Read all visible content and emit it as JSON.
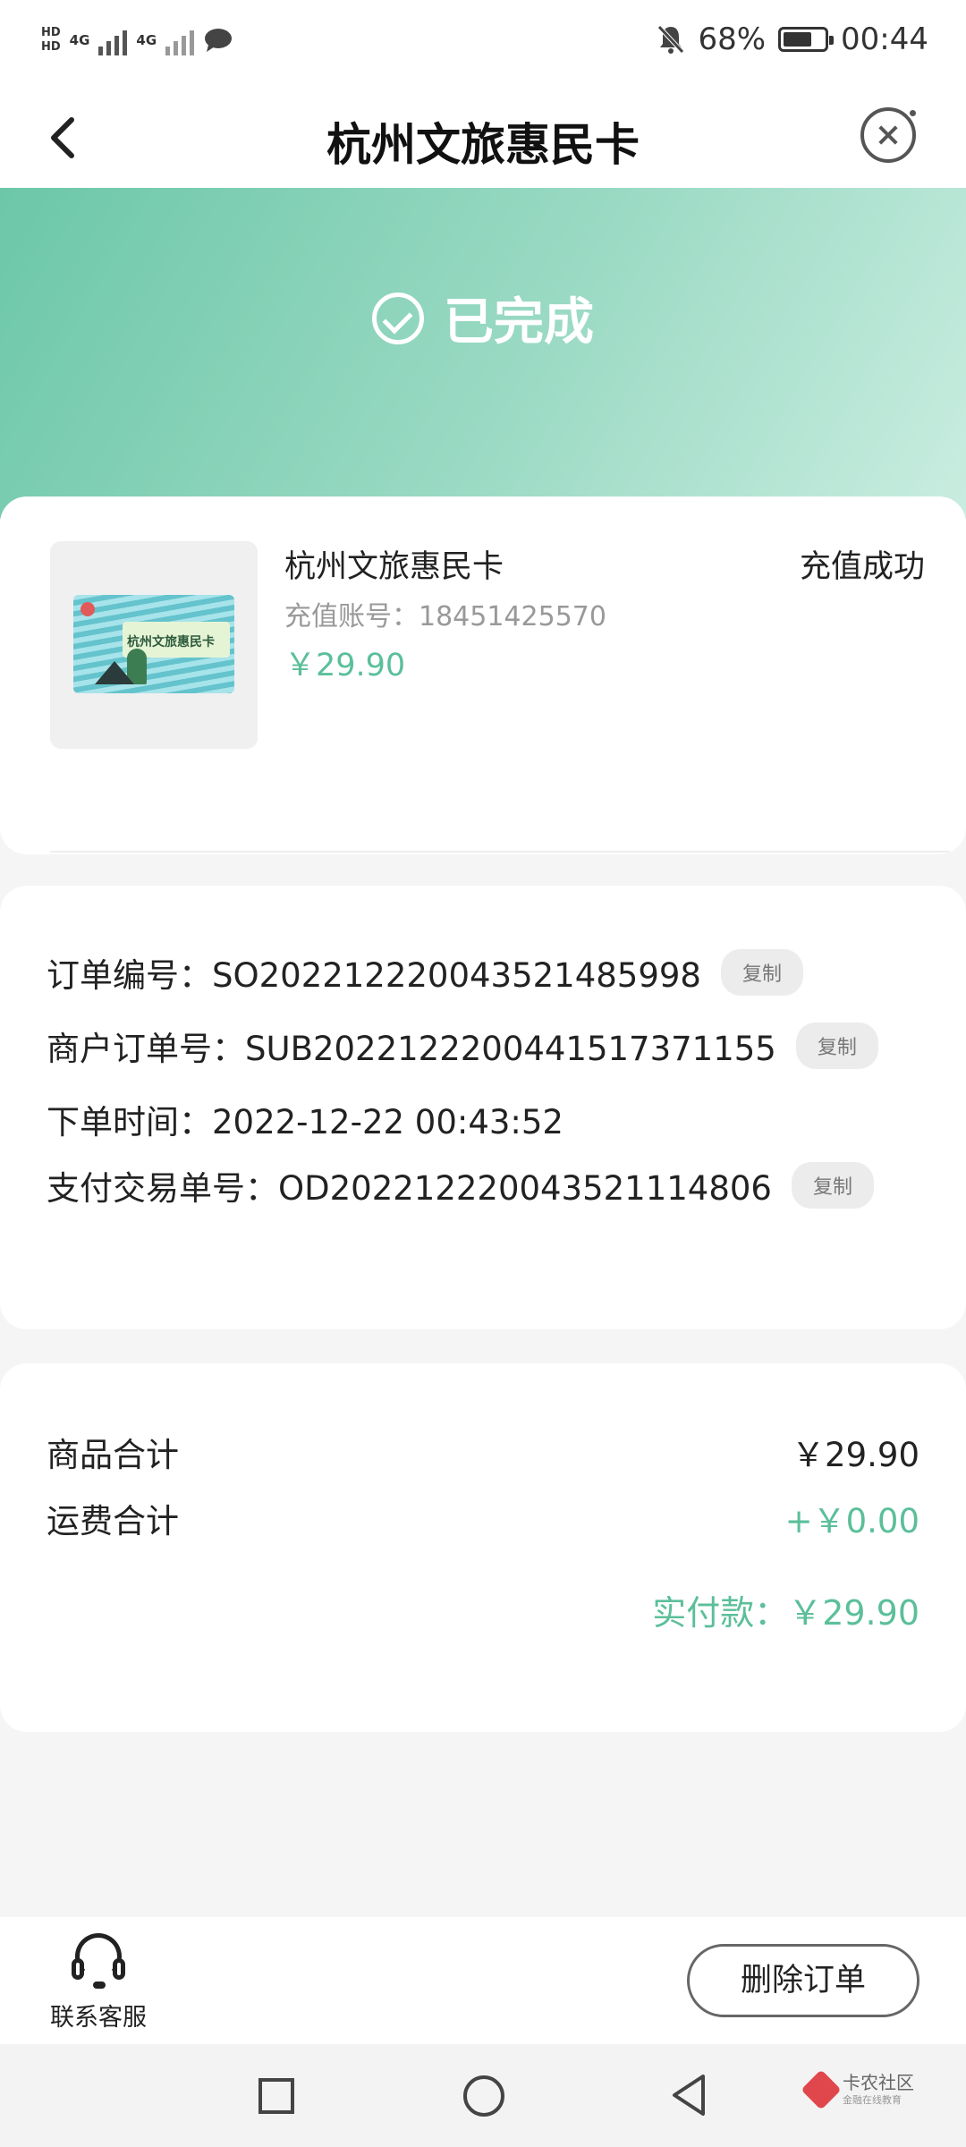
{
  "status_bar": {
    "network_left": "HD",
    "network_type_1": "4G",
    "network_type_2": "4G",
    "battery_percent": "68%",
    "time": "00:44",
    "icons": [
      "signal-icon",
      "chat-bubble-icon",
      "mute-bell-icon",
      "battery-icon"
    ]
  },
  "header": {
    "title": "杭州文旅惠民卡"
  },
  "banner": {
    "status": "已完成"
  },
  "product": {
    "name": "杭州文旅惠民卡",
    "account": "充值账号：18451425570",
    "price": "￥29.90",
    "status": "充值成功",
    "image_text": "杭州文旅惠民卡"
  },
  "order": {
    "order_no": "订单编号：SO202212220043521485998",
    "merchant_no": "商户订单号：SUB20221222004415173711​55",
    "order_time": "下单时间：2022-12-22 00:43:52",
    "pay_no": "支付交易单号：OD202212220043521114806",
    "copy_label": "复制"
  },
  "summary": {
    "goods_label": "商品合计",
    "goods_value": "￥29.90",
    "shipping_label": "运费合计",
    "shipping_value": "+￥0.00",
    "paid": "实付款：￥29.90"
  },
  "bottom": {
    "service_label": "联系客服",
    "delete_label": "删除订单"
  },
  "watermark": {
    "title": "卡农社区",
    "subtitle": "金融在线教育"
  },
  "colors": {
    "accent": "#5bbf9a",
    "banner_start": "#6cc7a8",
    "banner_end": "#c9ede0"
  }
}
